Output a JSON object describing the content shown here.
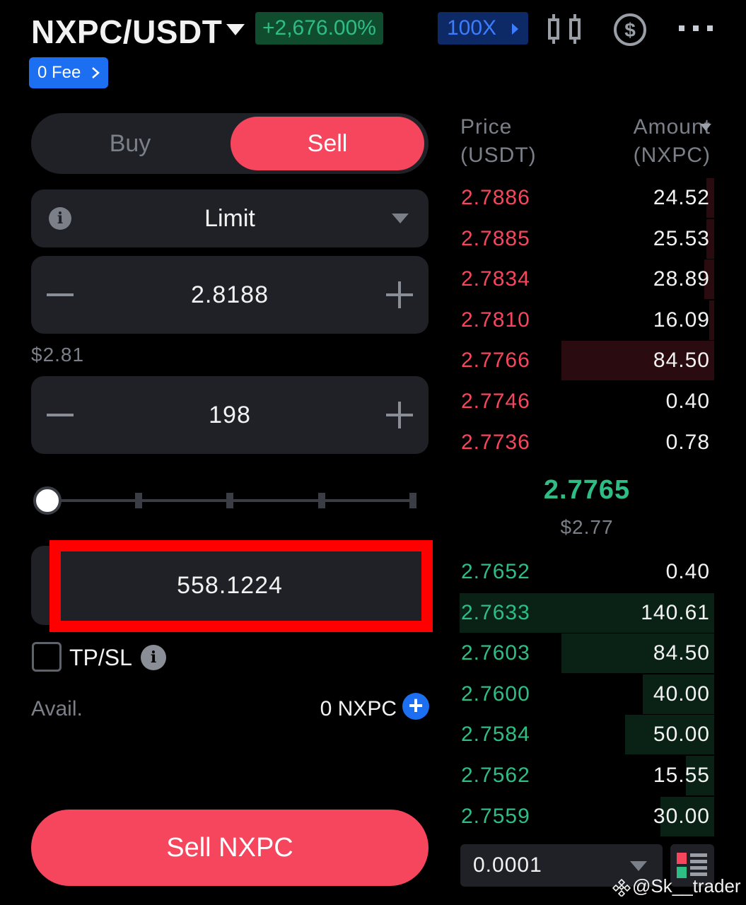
{
  "header": {
    "pair": "NXPC/USDT",
    "change": "+2,676.00%",
    "leverage": "100X",
    "fee_badge": "0 Fee"
  },
  "icons": [
    "candlestick-chart-icon",
    "dollar-coin-icon",
    "more-icon",
    "info-icon",
    "plus-circle-icon",
    "orderbook-layout-icon"
  ],
  "toggle": {
    "buy": "Buy",
    "sell": "Sell",
    "active": "Sell"
  },
  "order_form": {
    "order_type": "Limit",
    "price": "2.8188",
    "price_usd": "$2.81",
    "amount": "198",
    "slider_percent": 0,
    "total": "558.1224",
    "tpsl_label": "TP/SL",
    "avail_label": "Avail.",
    "avail_value": "0 NXPC",
    "submit": "Sell NXPC"
  },
  "orderbook": {
    "price_header_1": "Price",
    "price_header_2": "(USDT)",
    "amount_header_1": "Amount",
    "amount_header_2": "(NXPC)",
    "asks": [
      {
        "price": "2.7886",
        "amount": "24.52",
        "depth": 0.03
      },
      {
        "price": "2.7885",
        "amount": "25.53",
        "depth": 0.03
      },
      {
        "price": "2.7834",
        "amount": "28.89",
        "depth": 0.04
      },
      {
        "price": "2.7810",
        "amount": "16.09",
        "depth": 0.02
      },
      {
        "price": "2.7766",
        "amount": "84.50",
        "depth": 0.6
      },
      {
        "price": "2.7746",
        "amount": "0.40",
        "depth": 0
      },
      {
        "price": "2.7736",
        "amount": "0.78",
        "depth": 0
      }
    ],
    "mid_price": "2.7765",
    "mid_usd": "$2.77",
    "bids": [
      {
        "price": "2.7652",
        "amount": "0.40",
        "depth": 0
      },
      {
        "price": "2.7633",
        "amount": "140.61",
        "depth": 1.0
      },
      {
        "price": "2.7603",
        "amount": "84.50",
        "depth": 0.6
      },
      {
        "price": "2.7600",
        "amount": "40.00",
        "depth": 0.28
      },
      {
        "price": "2.7584",
        "amount": "50.00",
        "depth": 0.35
      },
      {
        "price": "2.7562",
        "amount": "15.55",
        "depth": 0.11
      },
      {
        "price": "2.7559",
        "amount": "30.00",
        "depth": 0.21
      }
    ],
    "precision": "0.0001"
  },
  "watermark": "@Sk__trader",
  "colors": {
    "up": "#2ebd85",
    "down": "#f6465d",
    "accent": "#1d6ff2",
    "highlight_box": "#ff0000"
  }
}
